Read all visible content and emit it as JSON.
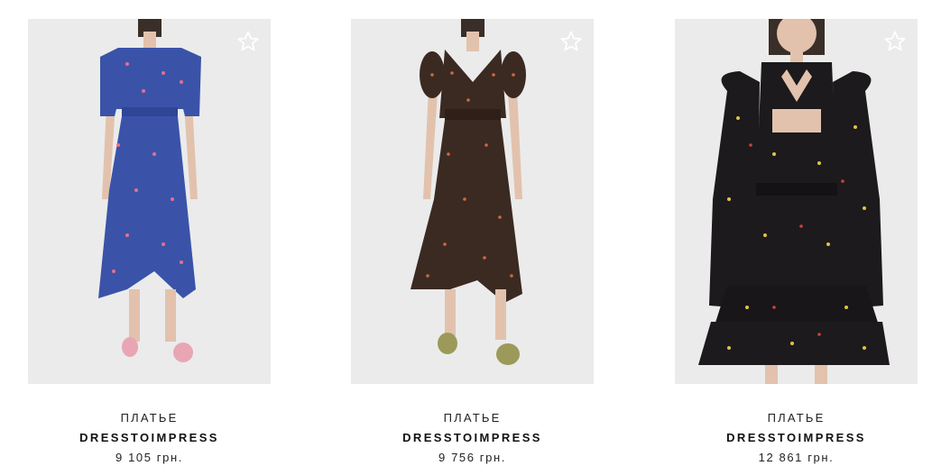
{
  "products": [
    {
      "type": "ПЛАТЬЕ",
      "brand": "DRESSTOIMPRESS",
      "price": "9 105 грн.",
      "image": "blue floral midi dress with puff sleeves",
      "dress_color": "#3a53a8",
      "favorite_icon": "star-outline-icon"
    },
    {
      "type": "ПЛАТЬЕ",
      "brand": "DRESSTOIMPRESS",
      "price": "9 756 грн.",
      "image": "brown floral wrap midi dress",
      "dress_color": "#3b2a22",
      "favorite_icon": "star-outline-icon"
    },
    {
      "type": "ПЛАТЬЕ",
      "brand": "DRESSTOIMPRESS",
      "price": "12 861 грн.",
      "image": "black floral mini dress with tiered ruffle skirt",
      "dress_color": "#1c1a1c",
      "favorite_icon": "star-outline-icon"
    }
  ],
  "colors": {
    "photo_background": "#ebebeb",
    "text": "#222222"
  }
}
